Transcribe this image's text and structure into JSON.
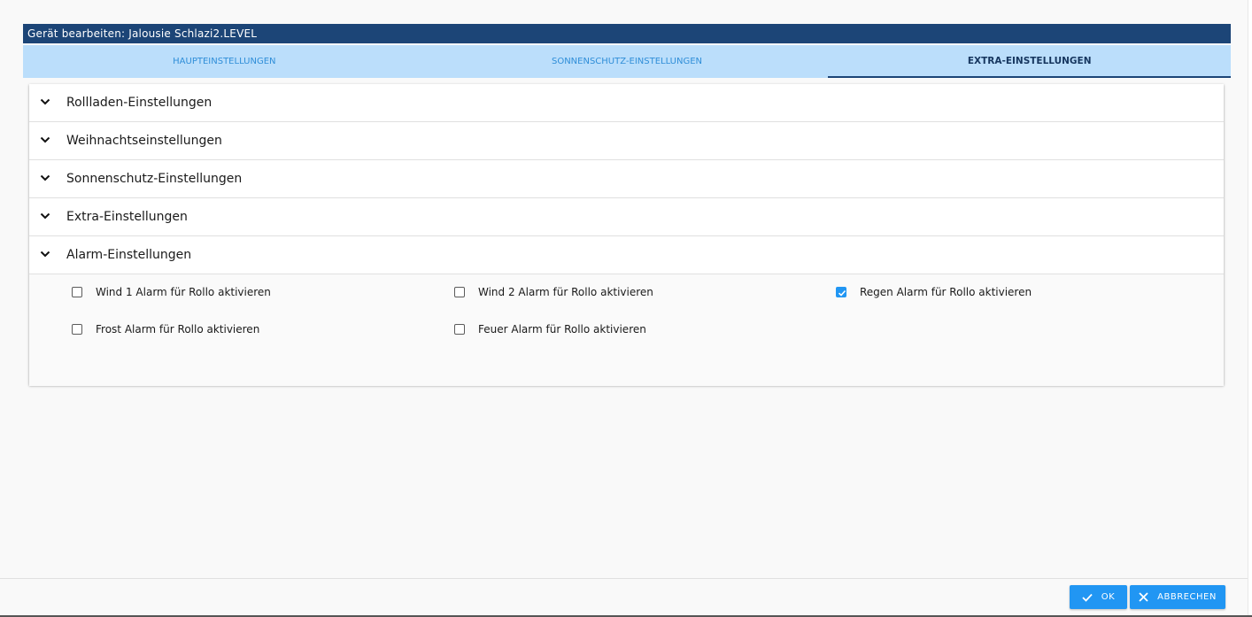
{
  "dialog": {
    "title": "Gerät bearbeiten: Jalousie Schlazi2.LEVEL"
  },
  "tabs": [
    {
      "label": "HAUPTEINSTELLUNGEN",
      "active": false
    },
    {
      "label": "SONNENSCHUTZ-EINSTELLUNGEN",
      "active": false
    },
    {
      "label": "EXTRA-EINSTELLUNGEN",
      "active": true
    }
  ],
  "sections": [
    {
      "label": "Rollladen-Einstellungen",
      "icon": "chevron-down-icon"
    },
    {
      "label": "Weihnachtseinstellungen",
      "icon": "chevron-down-icon"
    },
    {
      "label": "Sonnenschutz-Einstellungen",
      "icon": "chevron-down-icon"
    },
    {
      "label": "Extra-Einstellungen",
      "icon": "chevron-down-icon"
    },
    {
      "label": "Alarm-Einstellungen",
      "icon": "chevron-down-icon"
    }
  ],
  "alarm": {
    "checkboxes": [
      {
        "label": "Wind 1 Alarm für Rollo aktivieren",
        "checked": false
      },
      {
        "label": "Wind 2 Alarm für Rollo aktivieren",
        "checked": false
      },
      {
        "label": "Regen Alarm für Rollo aktivieren",
        "checked": true
      },
      {
        "label": "Frost Alarm für Rollo aktivieren",
        "checked": false
      },
      {
        "label": "Feuer Alarm für Rollo aktivieren",
        "checked": false
      }
    ]
  },
  "footer": {
    "ok_label": "OK",
    "cancel_label": "ABBRECHEN",
    "ok_icon": "check-icon",
    "cancel_icon": "close-icon"
  },
  "colors": {
    "title_bg": "#1c4577",
    "tab_bg": "#bbdefb",
    "accent": "#2196f3"
  }
}
